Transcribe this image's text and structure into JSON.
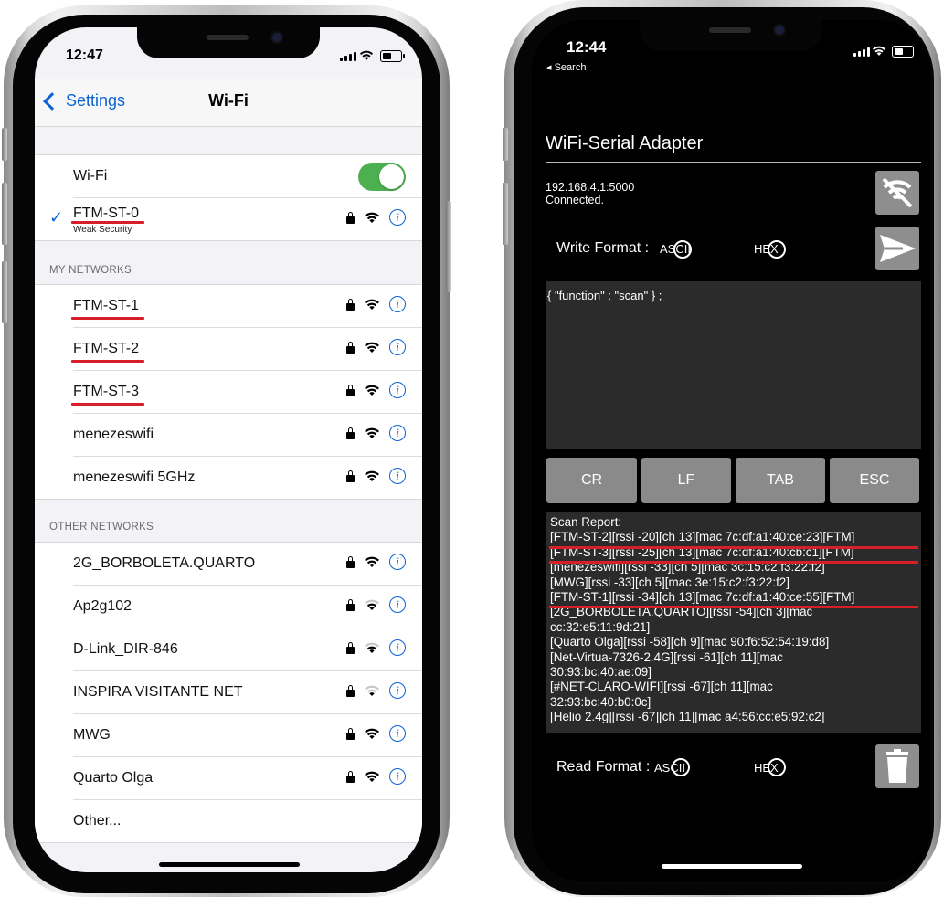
{
  "left_phone": {
    "status_time": "12:47",
    "nav": {
      "back_label": "Settings",
      "title": "Wi-Fi"
    },
    "wifi_row": {
      "label": "Wi-Fi",
      "enabled": true
    },
    "connected": {
      "name": "FTM-ST-0",
      "subtitle": "Weak Security"
    },
    "my_networks_header": "MY NETWORKS",
    "my_networks": [
      "FTM-ST-1",
      "FTM-ST-2",
      "FTM-ST-3",
      "menezeswifi",
      "menezeswifi 5GHz"
    ],
    "other_networks_header": "OTHER NETWORKS",
    "other_networks": [
      "2G_BORBOLETA.QUARTO",
      "Ap2g102",
      "D-Link_DIR-846",
      "INSPIRA VISITANTE NET",
      "MWG",
      "Quarto Olga"
    ],
    "other_label": "Other...",
    "accent_color": "#0a62d6",
    "toggle_color": "#4cb051",
    "underline_color": "#d91e2a"
  },
  "right_phone": {
    "status_time": "12:44",
    "back_label": "◂ Search",
    "app_title": "WiFi-Serial Adapter",
    "address": "192.168.4.1:5000",
    "connection_status": "Connected.",
    "write_format_label": "Write Format :",
    "read_format_label": "Read Format :",
    "ascii_label": "ASCII",
    "hex_label": "HEX",
    "command_text": "{ \"function\" : \"scan\" } ;",
    "control_buttons": [
      "CR",
      "LF",
      "TAB",
      "ESC"
    ],
    "scan_report": [
      "Scan Report:",
      "[FTM-ST-2][rssi -20][ch 13][mac 7c:df:a1:40:ce:23][FTM]",
      "[FTM-ST-3][rssi -25][ch 13][mac 7c:df:a1:40:cb:c1][FTM]",
      "[menezeswifi][rssi -33][ch 5][mac 3c:15:c2:f3:22:f2]",
      "[MWG][rssi -33][ch 5][mac 3e:15:c2:f3:22:f2]",
      "[FTM-ST-1][rssi -34][ch 13][mac 7c:df:a1:40:ce:55][FTM]",
      "[2G_BORBOLETA.QUARTO][rssi -54][ch 3][mac",
      "cc:32:e5:11:9d:21]",
      "[Quarto Olga][rssi -58][ch 9][mac 90:f6:52:54:19:d8]",
      "[Net-Virtua-7326-2.4G][rssi -61][ch 11][mac",
      "30:93:bc:40:ae:09]",
      "[#NET-CLARO-WIFI][rssi -67][ch 11][mac",
      "32:93:bc:40:b0:0c]",
      "[Helio 2.4g][rssi -67][ch 11][mac a4:56:cc:e5:92:c2]"
    ],
    "icons": [
      "disconnect-icon",
      "send-icon",
      "trash-icon"
    ]
  }
}
